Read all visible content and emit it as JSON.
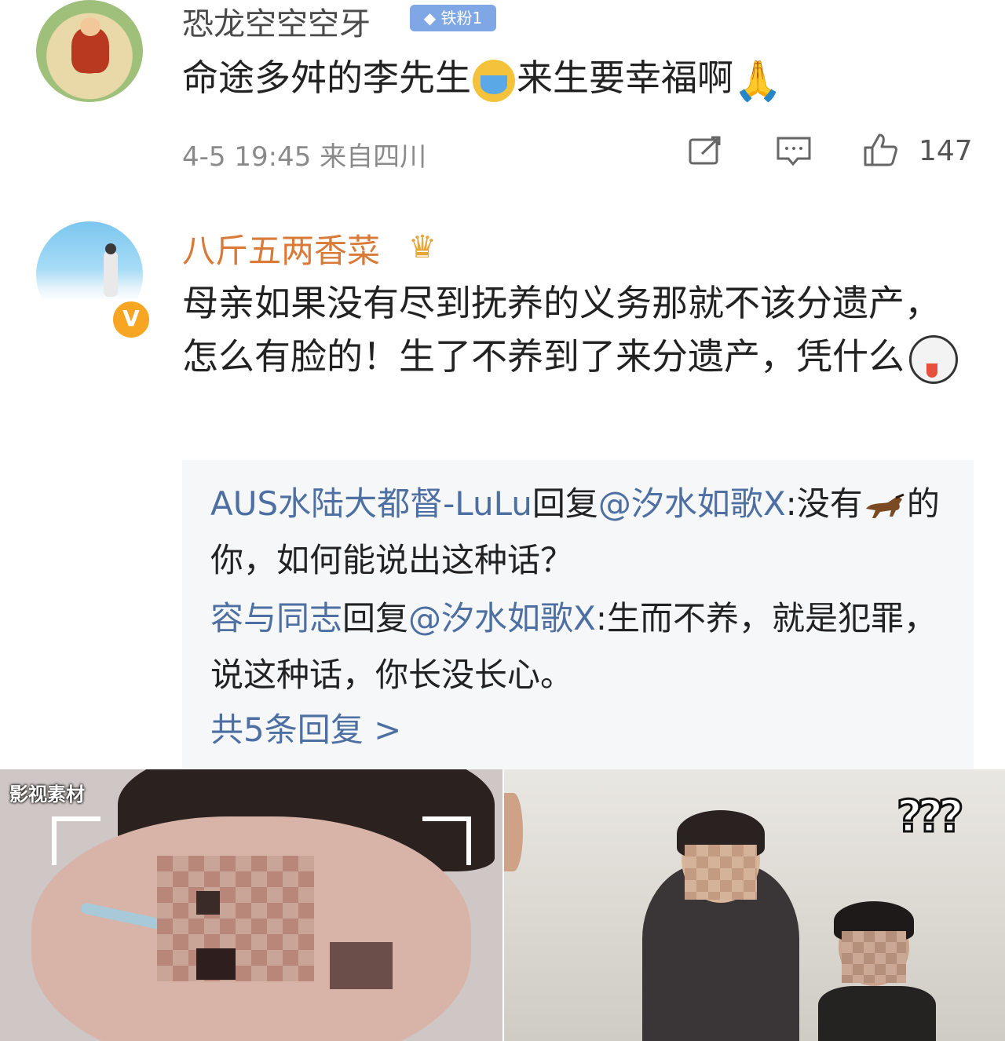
{
  "comments": [
    {
      "username": "恐龙空空空牙",
      "badge": "铁粉1",
      "text_a": "命途多舛的李先生",
      "emoji_a": "crying-face-emoji",
      "text_b": "来生要幸福啊",
      "emoji_b": "folded-hands-emoji",
      "meta": "4-5 19:45 来自四川",
      "likes": "147"
    },
    {
      "username": "八斤五两香菜",
      "badge_icon": "crown-icon",
      "verified_mark": "V",
      "text": "母亲如果没有尽到抚养的义务那就不该分遗产，怎么有脸的！生了不养到了来分遗产，凭什么",
      "emoji": "husky-dog-emoji",
      "replies": [
        {
          "author": "AUS水陆大都督-LuLu",
          "action": "回复",
          "target": "@汐水如歌X",
          "text_a": ":没有",
          "emoji": "horse-emoji",
          "text_b": "的你，如何能说出这种话？"
        },
        {
          "author": "容与同志",
          "action": "回复",
          "target": "@汐水如歌X",
          "text": ":生而不养，就是犯罪，说这种话，你长没长心。"
        }
      ],
      "more_replies": "共5条回复 >"
    }
  ],
  "images": {
    "left_watermark": "影视素材",
    "right_overlay": "???"
  },
  "colors": {
    "username": "#4a4a4a",
    "vip_username": "#d97a39",
    "reply_link": "#4d6fa1",
    "meta": "#8a8a8a",
    "reply_bg": "#f6f7f9"
  }
}
